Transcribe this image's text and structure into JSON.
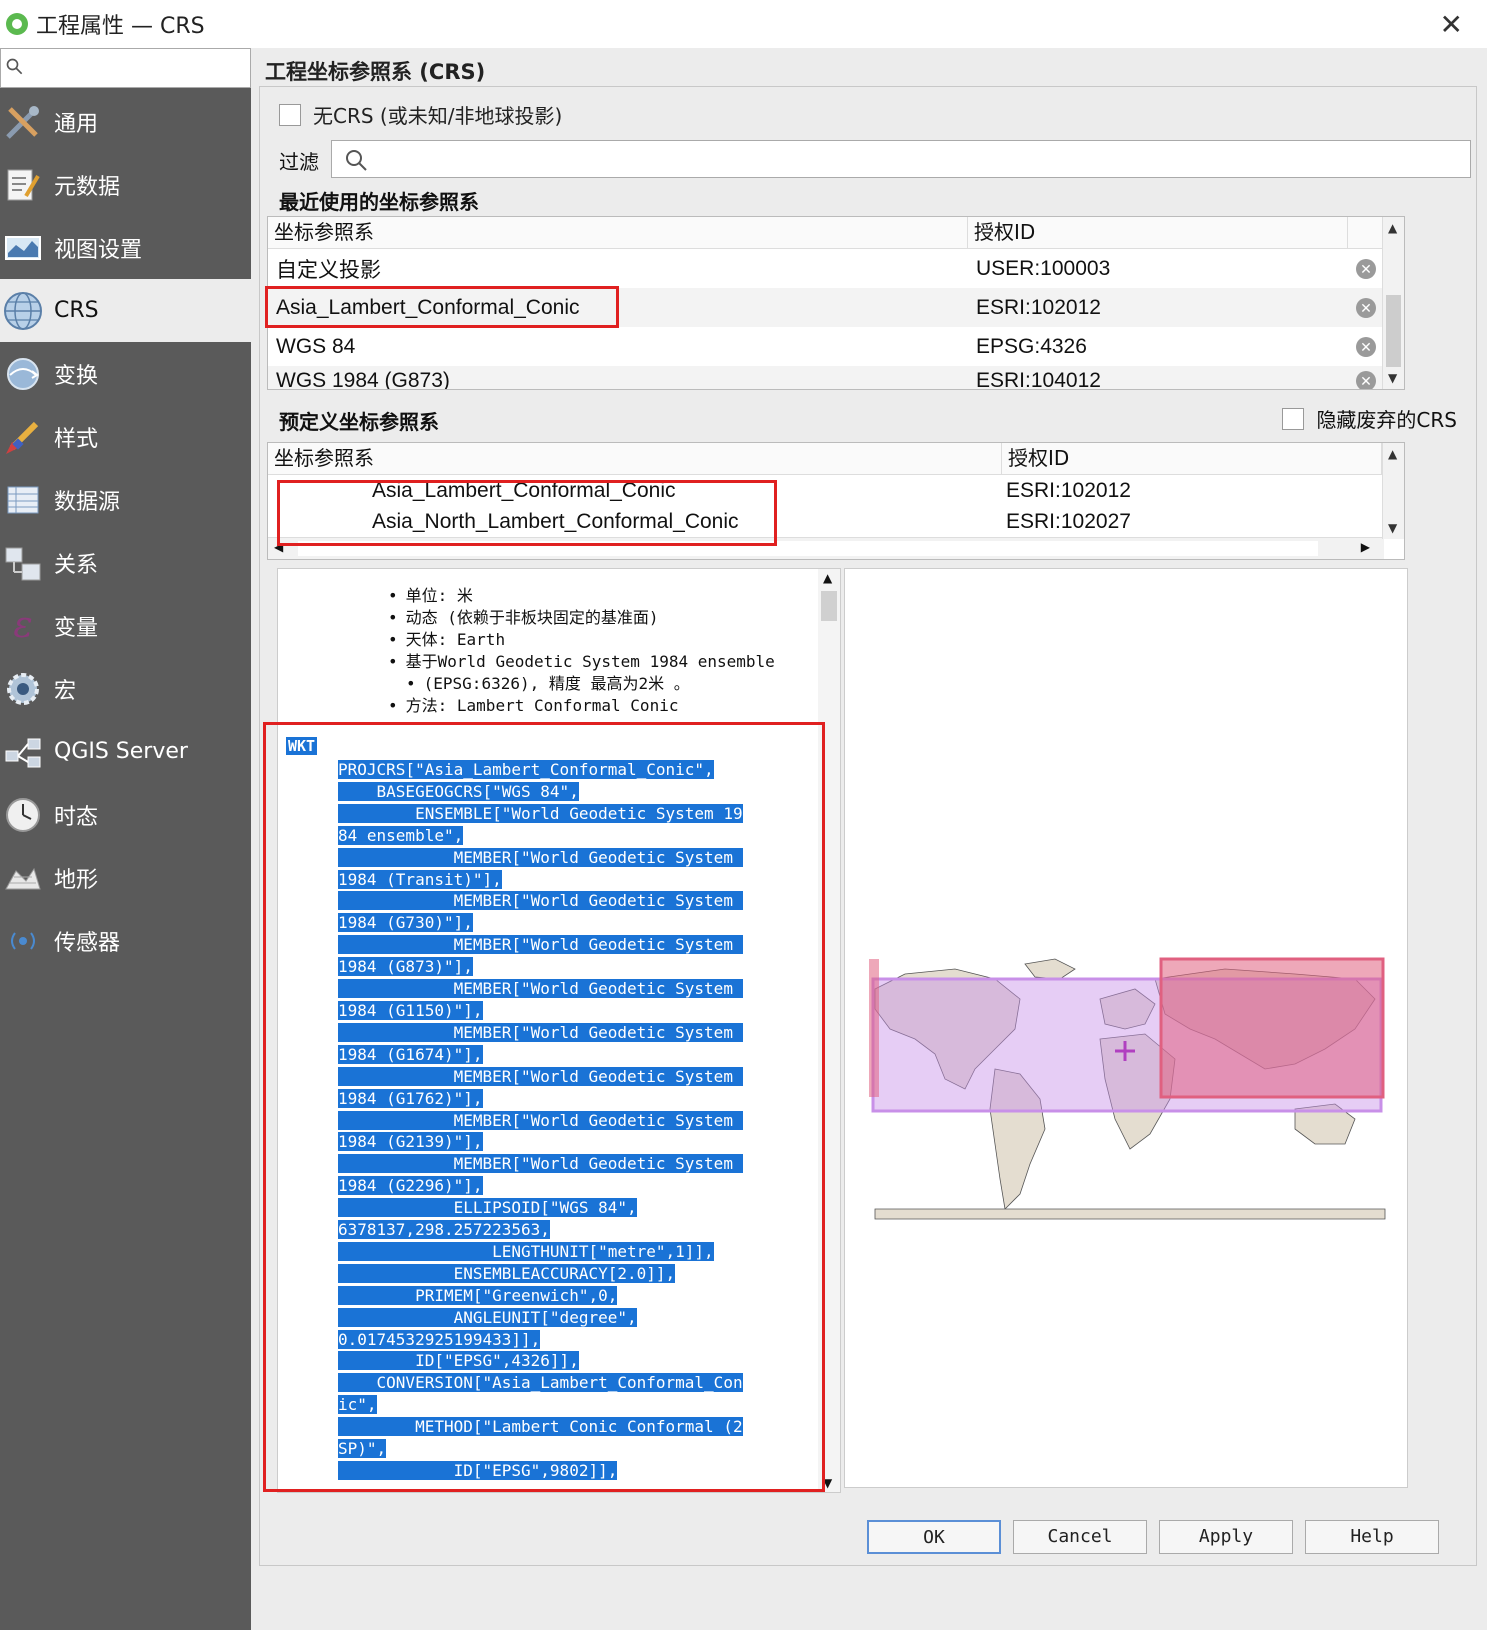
{
  "window": {
    "title": "工程属性 — CRS"
  },
  "sidebar": {
    "search_placeholder": "",
    "items": [
      {
        "label": "通用",
        "icon": "tools-icon"
      },
      {
        "label": "元数据",
        "icon": "document-pencil-icon"
      },
      {
        "label": "视图设置",
        "icon": "map-view-icon"
      },
      {
        "label": "CRS",
        "icon": "globe-icon"
      },
      {
        "label": "变换",
        "icon": "globe-transform-icon"
      },
      {
        "label": "样式",
        "icon": "brush-icon"
      },
      {
        "label": "数据源",
        "icon": "table-icon"
      },
      {
        "label": "关系",
        "icon": "relations-icon"
      },
      {
        "label": "变量",
        "icon": "epsilon-icon"
      },
      {
        "label": "宏",
        "icon": "gear-icon"
      },
      {
        "label": "QGIS Server",
        "icon": "network-icon"
      },
      {
        "label": "时态",
        "icon": "clock-icon"
      },
      {
        "label": "地形",
        "icon": "terrain-icon"
      },
      {
        "label": "传感器",
        "icon": "sensor-icon"
      }
    ],
    "selected": "CRS"
  },
  "main": {
    "section_title": "工程坐标参照系 (CRS)",
    "no_crs_label": "无CRS (或未知/非地球投影)",
    "filter_label": "过滤",
    "filter_value": "",
    "recent_title": "最近使用的坐标参照系",
    "recent_headers": [
      "坐标参照系",
      "授权ID"
    ],
    "recent_rows": [
      {
        "name": "自定义投影",
        "id": "USER:100003"
      },
      {
        "name": "Asia_Lambert_Conformal_Conic",
        "id": "ESRI:102012"
      },
      {
        "name": "WGS 84",
        "id": "EPSG:4326"
      },
      {
        "name": "WGS 1984 (G873)",
        "id": "ESRI:104012"
      }
    ],
    "predef_title": "预定义坐标参照系",
    "hide_deprecated_label": "隐藏废弃的CRS",
    "predef_headers": [
      "坐标参照系",
      "授权ID"
    ],
    "predef_rows": [
      {
        "name": "Asia_Lambert_Conformal_Conic",
        "id": "ESRI:102012"
      },
      {
        "name": "Asia_North_Lambert_Conformal_Conic",
        "id": "ESRI:102027"
      }
    ],
    "info": {
      "bullets": [
        "单位: 米",
        "动态 (依赖于非板块固定的基准面)",
        "天体: Earth",
        "基于World Geodetic System 1984 ensemble",
        "(EPSG:6326), 精度 最高为2米 。",
        "方法: Lambert Conformal Conic"
      ],
      "wkt_label": "WKT",
      "wkt_lines": [
        "PROJCRS[\"Asia_Lambert_Conformal_Conic\",",
        "    BASEGEOGCRS[\"WGS 84\",",
        "        ENSEMBLE[\"World Geodetic System 19",
        "84 ensemble\",",
        "            MEMBER[\"World Geodetic System ",
        "1984 (Transit)\"],",
        "            MEMBER[\"World Geodetic System ",
        "1984 (G730)\"],",
        "            MEMBER[\"World Geodetic System ",
        "1984 (G873)\"],",
        "            MEMBER[\"World Geodetic System ",
        "1984 (G1150)\"],",
        "            MEMBER[\"World Geodetic System ",
        "1984 (G1674)\"],",
        "            MEMBER[\"World Geodetic System ",
        "1984 (G1762)\"],",
        "            MEMBER[\"World Geodetic System ",
        "1984 (G2139)\"],",
        "            MEMBER[\"World Geodetic System ",
        "1984 (G2296)\"],",
        "            ELLIPSOID[\"WGS 84\",",
        "6378137,298.257223563,",
        "                LENGTHUNIT[\"metre\",1]],",
        "            ENSEMBLEACCURACY[2.0]],",
        "        PRIMEM[\"Greenwich\",0,",
        "            ANGLEUNIT[\"degree\",",
        "0.0174532925199433]],",
        "        ID[\"EPSG\",4326]],",
        "    CONVERSION[\"Asia_Lambert_Conformal_Con",
        "ic\",",
        "        METHOD[\"Lambert Conic Conformal (2",
        "SP)\",",
        "            ID[\"EPSG\",9802]],"
      ]
    }
  },
  "buttons": {
    "ok": "OK",
    "cancel": "Cancel",
    "apply": "Apply",
    "help": "Help"
  },
  "colors": {
    "sidebar_bg": "#5a5a5a",
    "selection_blue": "#1a73d6",
    "highlight_red": "#e02020",
    "extent_pink": "#e060a0",
    "extent_purple": "#c890e8"
  }
}
